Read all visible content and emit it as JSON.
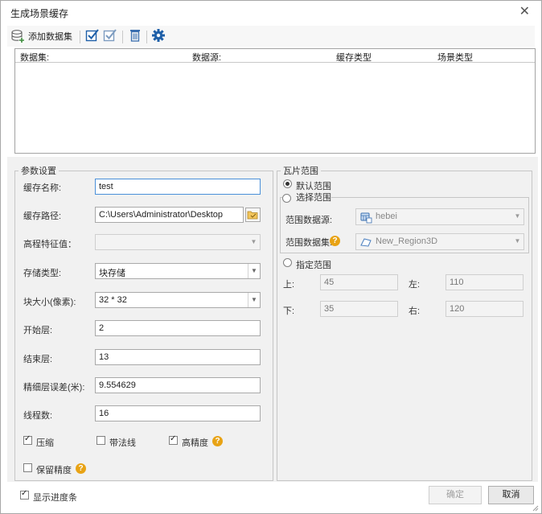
{
  "window": {
    "title": "生成场景缓存",
    "close_glyph": "✕"
  },
  "toolbar": {
    "add_dataset_label": "添加数据集",
    "add_dataset_icon": "database-add-icon",
    "select_all_icon": "check-all-icon",
    "invert_select_icon": "check-invert-icon",
    "delete_icon": "trash-icon",
    "settings_icon": "gear-icon"
  },
  "table": {
    "columns": [
      "数据集:",
      "数据源:",
      "缓存类型",
      "场景类型"
    ],
    "rows": []
  },
  "params": {
    "legend": "参数设置",
    "cache_name_label": "缓存名称:",
    "cache_name_value": "test",
    "cache_path_label": "缓存路径:",
    "cache_path_value": "C:\\Users\\Administrator\\Desktop",
    "elevation_label": "高程特征值：",
    "elevation_value": "",
    "storage_type_label": "存储类型:",
    "storage_type_value": "块存储",
    "block_size_label": "块大小(像素):",
    "block_size_value": "32 * 32",
    "start_level_label": "开始层:",
    "start_level_value": "2",
    "end_level_label": "结束层:",
    "end_level_value": "13",
    "fine_error_label": "精细层误差(米):",
    "fine_error_value": "9.554629",
    "threads_label": "线程数:",
    "threads_value": "16",
    "compress_label": "压缩",
    "compress_checked": true,
    "normals_label": "带法线",
    "normals_checked": false,
    "high_precision_label": "高精度",
    "high_precision_checked": true,
    "keep_precision_label": "保留精度",
    "keep_precision_checked": false,
    "help_glyph": "?"
  },
  "tile_range": {
    "legend": "瓦片范围",
    "default_label": "默认范围",
    "select_label": "选择范围",
    "range_source_label": "范围数据源:",
    "range_source_value": "hebei",
    "range_dataset_label": "范围数据集:",
    "range_dataset_value": "New_Region3D",
    "specify_label": "指定范围",
    "top_label": "上:",
    "top_value": "45",
    "left_label": "左:",
    "left_value": "110",
    "bottom_label": "下:",
    "bottom_value": "35",
    "right_label": "右:",
    "right_value": "120",
    "selected_option": "default"
  },
  "footer": {
    "show_progress_label": "显示进度条",
    "show_progress_checked": true,
    "ok_label": "确定",
    "cancel_label": "取消"
  },
  "colors": {
    "accent": "#1e5fa8",
    "help": "#e8a315",
    "focus_border": "#4a90d9"
  }
}
